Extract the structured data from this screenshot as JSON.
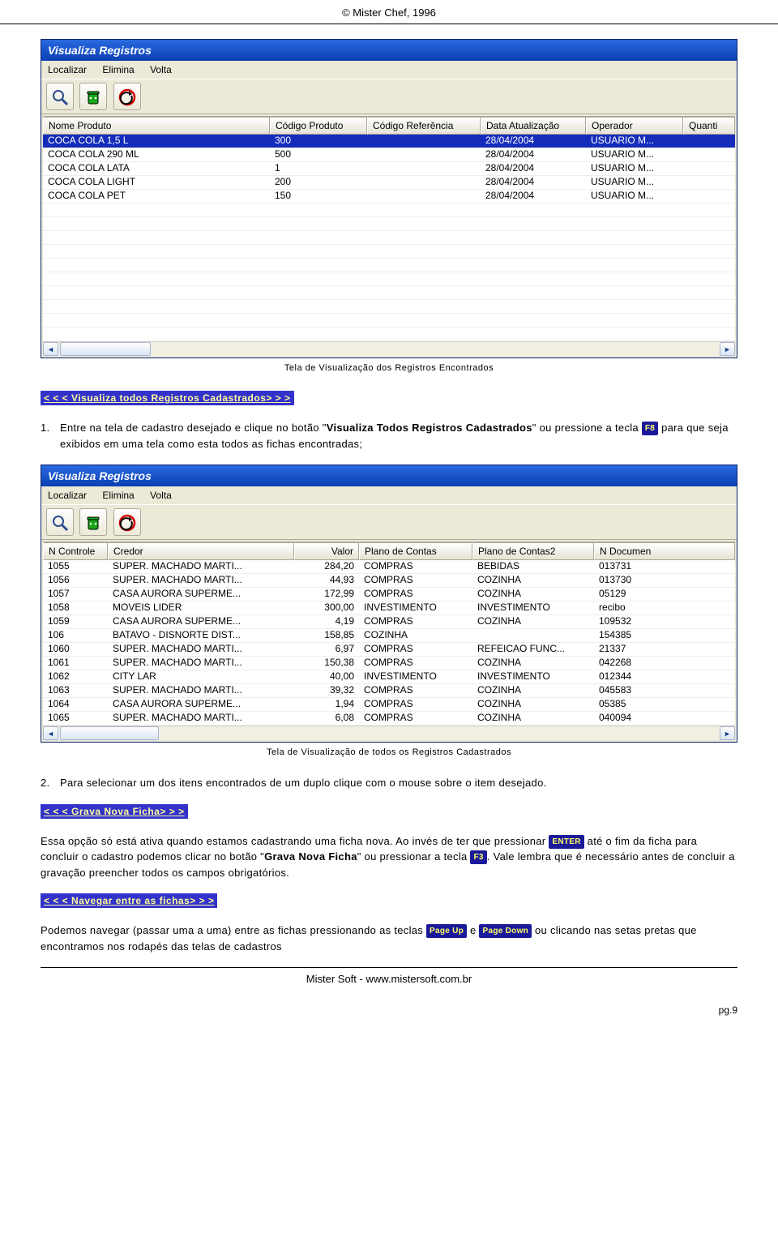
{
  "copyright": "© Mister Chef, 1996",
  "win1": {
    "title": "Visualiza Registros",
    "menu": [
      "Localizar",
      "Elimina",
      "Volta"
    ],
    "columns": [
      "Nome Produto",
      "Código Produto",
      "Código Referência",
      "Data Atualização",
      "Operador",
      "Quanti"
    ],
    "rows": [
      {
        "sel": true,
        "c": [
          "COCA COLA 1,5 L",
          "300",
          "",
          "28/04/2004",
          "USUARIO M...",
          ""
        ]
      },
      {
        "sel": false,
        "c": [
          "COCA COLA 290 ML",
          "500",
          "",
          "28/04/2004",
          "USUARIO M...",
          ""
        ]
      },
      {
        "sel": false,
        "c": [
          "COCA COLA LATA",
          "1",
          "",
          "28/04/2004",
          "USUARIO M...",
          ""
        ]
      },
      {
        "sel": false,
        "c": [
          "COCA COLA LIGHT",
          "200",
          "",
          "28/04/2004",
          "USUARIO M...",
          ""
        ]
      },
      {
        "sel": false,
        "c": [
          "COCA COLA PET",
          "150",
          "",
          "28/04/2004",
          "USUARIO M...",
          ""
        ]
      }
    ],
    "caption": "Tela de Visualização dos Registros Encontrados"
  },
  "sect1": "< < < Visualiza todos Registros Cadastrados> > >",
  "para1": {
    "num": "1.",
    "t1": "Entre na tela de cadastro desejado e clique no botão \"",
    "b1": "Visualiza Todos Registros Cadastrados",
    "t2": "\" ou pressione a tecla ",
    "key": "F8",
    "t3": " para que seja exibidos em uma tela como esta todos as fichas encontradas;"
  },
  "win2": {
    "title": "Visualiza Registros",
    "menu": [
      "Localizar",
      "Elimina",
      "Volta"
    ],
    "columns": [
      "N Controle",
      "Credor",
      "Valor",
      "Plano de Contas",
      "Plano de Contas2",
      "N Documen"
    ],
    "rows": [
      {
        "c": [
          "1055",
          "SUPER. MACHADO MARTI...",
          "284,20",
          "COMPRAS",
          "BEBIDAS",
          "013731"
        ]
      },
      {
        "c": [
          "1056",
          "SUPER. MACHADO MARTI...",
          "44,93",
          "COMPRAS",
          "COZINHA",
          "013730"
        ]
      },
      {
        "c": [
          "1057",
          "CASA AURORA SUPERME...",
          "172,99",
          "COMPRAS",
          "COZINHA",
          "05129"
        ]
      },
      {
        "c": [
          "1058",
          "MOVEIS LIDER",
          "300,00",
          "INVESTIMENTO",
          "INVESTIMENTO",
          "recibo"
        ]
      },
      {
        "c": [
          "1059",
          "CASA AURORA SUPERME...",
          "4,19",
          "COMPRAS",
          "COZINHA",
          "109532"
        ]
      },
      {
        "c": [
          "106",
          "BATAVO - DISNORTE DIST...",
          "158,85",
          "COZINHA",
          "",
          "154385"
        ]
      },
      {
        "c": [
          "1060",
          "SUPER. MACHADO MARTI...",
          "6,97",
          "COMPRAS",
          "REFEICAO FUNC...",
          "21337"
        ]
      },
      {
        "c": [
          "1061",
          "SUPER. MACHADO MARTI...",
          "150,38",
          "COMPRAS",
          "COZINHA",
          "042268"
        ]
      },
      {
        "c": [
          "1062",
          "CITY LAR",
          "40,00",
          "INVESTIMENTO",
          "INVESTIMENTO",
          "012344"
        ]
      },
      {
        "c": [
          "1063",
          "SUPER. MACHADO MARTI...",
          "39,32",
          "COMPRAS",
          "COZINHA",
          "045583"
        ]
      },
      {
        "c": [
          "1064",
          "CASA AURORA SUPERME...",
          "1,94",
          "COMPRAS",
          "COZINHA",
          "05385"
        ]
      },
      {
        "c": [
          "1065",
          "SUPER. MACHADO MARTI...",
          "6,08",
          "COMPRAS",
          "COZINHA",
          "040094"
        ]
      }
    ],
    "caption": "Tela de Visualização de todos os Registros Cadastrados"
  },
  "para2": {
    "num": "2.",
    "text": "Para selecionar um dos itens encontrados de um duplo clique com o mouse sobre o item desejado."
  },
  "sect2": "< < < Grava Nova Ficha> > >",
  "para3": {
    "t1": "Essa opção só está ativa quando estamos cadastrando uma ficha nova. Ao invés de ter que pressionar ",
    "k1": "ENTER",
    "t2": " até o fim da ficha para concluir o cadastro podemos clicar no botão \"",
    "b1": "Grava Nova Ficha",
    "t3": "\" ou pressionar a tecla ",
    "k2": "F3",
    "t4": ". Vale lembra que é necessário antes de concluir a gravação preencher todos os campos obrigatórios."
  },
  "sect3": "< < < Navegar entre as fichas> > >",
  "para4": {
    "t1": "Podemos navegar (passar uma a uma) entre as fichas pressionando as teclas ",
    "k1": "Page Up",
    "t2": " e ",
    "k2": "Page Down",
    "t3": " ou clicando nas setas pretas que encontramos nos rodapés das telas de cadastros"
  },
  "footer": "Mister Soft - www.mistersoft.com.br",
  "pageNum": "pg.9"
}
